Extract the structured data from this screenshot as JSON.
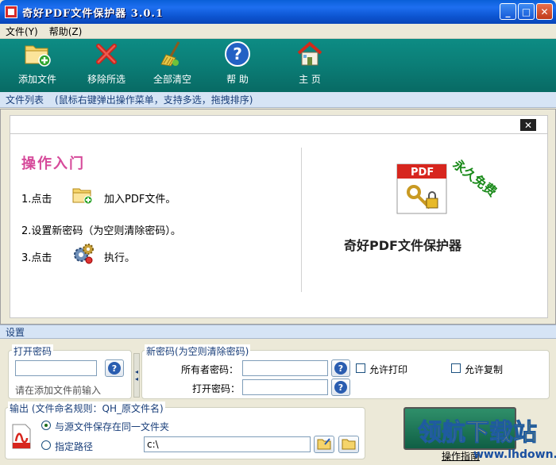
{
  "window": {
    "title": "奇好PDF文件保护器  3.0.1"
  },
  "menu": {
    "items": [
      "文件(Y)",
      "帮助(Z)"
    ]
  },
  "toolbar": {
    "add": "添加文件",
    "remove": "移除所选",
    "clear": "全部清空",
    "help": "帮 助",
    "home": "主 页"
  },
  "infobar": {
    "label": "文件列表",
    "hint": "(鼠标右键弹出操作菜单，支持多选，拖拽排序)"
  },
  "guide": {
    "title": "操作入门",
    "step1_prefix": "1.点击",
    "step1_suffix": "加入PDF文件。",
    "step2": "2.设置新密码（为空则清除密码）。",
    "step3_prefix": "3.点击",
    "step3_suffix": "执行。",
    "product_name": "奇好PDF文件保护器",
    "free_stamp": "永久免费",
    "pdf_logo_text": "PDF"
  },
  "settings": {
    "header": "设置",
    "open_group": {
      "legend": "打开密码",
      "hint": "请在添加文件前输入",
      "value": ""
    },
    "new_group": {
      "legend": "新密码(为空则清除密码)",
      "owner_label": "所有者密码：",
      "open_label": "打开密码：",
      "owner_value": "",
      "open_value": "",
      "allow_print": "允许打印",
      "allow_copy": "允许复制"
    },
    "output_group": {
      "legend": "输出 (文件命名规则：QH_原文件名)",
      "same_folder": "与源文件保存在同一文件夹",
      "custom_path": "指定路径",
      "path_value": "c:\\"
    }
  },
  "watermark": {
    "text": "领航下载站",
    "url": "www.lhdown.com",
    "link": "操作指南"
  }
}
